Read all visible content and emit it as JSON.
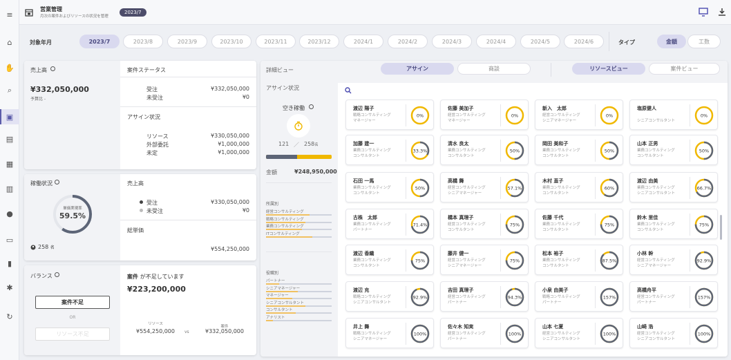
{
  "header": {
    "title": "営業管理",
    "subtitle": "月次の案件およびリソースの状況を管理",
    "period_badge": "2023/7"
  },
  "sidebar": {
    "items": [
      "menu-icon",
      "home-icon",
      "hand-icon",
      "search-doc-icon",
      "calendar-icon",
      "card-icon",
      "building-icon",
      "office-icon",
      "person-icon",
      "wallet-icon",
      "chart-icon",
      "gear-icon",
      "refresh-icon"
    ],
    "active": 4
  },
  "month_bar": {
    "label": "対象年月",
    "months": [
      "2023/7",
      "2023/8",
      "2023/9",
      "2023/10",
      "2023/11",
      "2023/12",
      "2024/1",
      "2024/2",
      "2024/3",
      "2024/4",
      "2024/5",
      "2024/6"
    ],
    "selected": "2023/7",
    "type_label": "タイプ",
    "types": [
      "金額",
      "工数"
    ],
    "selected_type": "金額"
  },
  "sales": {
    "title": "売上高",
    "total": "¥332,050,000",
    "budget_label": "予算比 -",
    "status_title": "案件ステータス",
    "received_label": "受注",
    "received_value": "¥332,050,000",
    "unreceived_label": "未受注",
    "unreceived_value": "¥0",
    "assign_title": "アサイン状況",
    "resource_label": "リソース",
    "resource_value": "¥330,050,000",
    "outsourced_label": "外部委託",
    "outsourced_value": "¥1,000,000",
    "undecided_label": "未定",
    "undecided_value": "¥1,000,000"
  },
  "utilization": {
    "title": "稼働状況",
    "gauge_label": "単価実現率",
    "gauge_value": "59.5%",
    "gauge_fraction": 0.595,
    "people": "258",
    "people_unit": "名",
    "sales_title": "売上高",
    "legend_received": "受注",
    "legend_received_value": "¥330,050,000",
    "legend_unreceived": "未受注",
    "legend_unreceived_value": "¥0",
    "unit_price_title": "総単価",
    "unit_price_value": "¥554,250,000"
  },
  "balance": {
    "title": "バランス",
    "shortage_btn": "案件不足",
    "or_label": "OR",
    "resource_shortage_btn": "リソース不足",
    "message_prefix": "案件",
    "message_suffix": "が不足しています",
    "amount": "¥223,200,000",
    "resource_label": "リソース",
    "resource_value": "¥554,250,000",
    "vs_label": "vs",
    "case_label": "案件",
    "case_value": "¥332,050,000"
  },
  "detail": {
    "title": "詳細ビュー",
    "tabs": [
      "アサイン",
      "商談"
    ],
    "selected_tab": "アサイン",
    "view_tabs": [
      "リソースビュー",
      "案件ビュー"
    ],
    "selected_view": "リソースビュー",
    "assign_status_title": "アサイン状況",
    "idle_label": "空き稼働",
    "idle_count": "121",
    "total_count": "258",
    "count_unit": "名",
    "idle_fraction": 0.469,
    "amount_label": "金額",
    "amount_value": "¥248,950,000",
    "dept_title": "所属別",
    "depts": [
      {
        "name": "経営コンサルティング",
        "fill": 0.66
      },
      {
        "name": "戦略コンサルティング",
        "fill": 0.6
      },
      {
        "name": "業務コンサルティング",
        "fill": 0.55
      },
      {
        "name": "ITコンサルティング",
        "fill": 0.7
      }
    ],
    "role_title": "役職別",
    "roles": [
      {
        "name": "パートナー",
        "fill": 0.2
      },
      {
        "name": "シニアマネージャー",
        "fill": 0.48
      },
      {
        "name": "マネージャー",
        "fill": 0.4
      },
      {
        "name": "シニアコンサルタント",
        "fill": 0.6
      },
      {
        "name": "コンサルタント",
        "fill": 0.45
      },
      {
        "name": "アナリスト",
        "fill": 0.1
      }
    ]
  },
  "resources": [
    {
      "name": "渡辺 陽子",
      "dept": "戦略コンサルティング",
      "role": "マネージャー",
      "pct": "0%",
      "frac": 0
    },
    {
      "name": "佐藤 美加子",
      "dept": "経営コンサルティング",
      "role": "マネージャー",
      "pct": "0%",
      "frac": 0
    },
    {
      "name": "新入　太郎",
      "dept": "経営コンサルティング",
      "role": "シニアマネージャー",
      "pct": "0%",
      "frac": 0
    },
    {
      "name": "塩原健人",
      "dept": "",
      "role": "シニアコンサルタント",
      "pct": "0%",
      "frac": 0
    },
    {
      "name": "加藤 建一",
      "dept": "業務コンサルティング",
      "role": "コンサルタント",
      "pct": "33.3%",
      "frac": 0.333
    },
    {
      "name": "清水 良太",
      "dept": "業務コンサルティング",
      "role": "コンサルタント",
      "pct": "50%",
      "frac": 0.5
    },
    {
      "name": "岡田 美和子",
      "dept": "業務コンサルティング",
      "role": "コンサルタント",
      "pct": "50%",
      "frac": 0.5
    },
    {
      "name": "山本 正男",
      "dept": "業務コンサルティング",
      "role": "コンサルタント",
      "pct": "50%",
      "frac": 0.5
    },
    {
      "name": "石田 一馬",
      "dept": "業務コンサルティング",
      "role": "コンサルタント",
      "pct": "50%",
      "frac": 0.5
    },
    {
      "name": "高橋 舞",
      "dept": "経営コンサルティング",
      "role": "シニアマネージャー",
      "pct": "57.1%",
      "frac": 0.571
    },
    {
      "name": "木村 直子",
      "dept": "業務コンサルティング",
      "role": "コンサルタント",
      "pct": "60%",
      "frac": 0.6
    },
    {
      "name": "渡辺 由美",
      "dept": "業務コンサルティング",
      "role": "シニアコンサルタント",
      "pct": "66.7%",
      "frac": 0.667
    },
    {
      "name": "古株　太郎",
      "dept": "業務コンサルティング",
      "role": "パートナー",
      "pct": "71.4%",
      "frac": 0.714
    },
    {
      "name": "橋本 真理子",
      "dept": "経営コンサルティング",
      "role": "コンサルタント",
      "pct": "75%",
      "frac": 0.75
    },
    {
      "name": "佐藤 千代",
      "dept": "業務コンサルティング",
      "role": "コンサルタント",
      "pct": "75%",
      "frac": 0.75
    },
    {
      "name": "鈴木 里佳",
      "dept": "業務コンサルティング",
      "role": "コンサルタント",
      "pct": "75%",
      "frac": 0.75
    },
    {
      "name": "渡辺 香織",
      "dept": "業務コンサルティング",
      "role": "コンサルタント",
      "pct": "75%",
      "frac": 0.75
    },
    {
      "name": "藤井 健一",
      "dept": "経営コンサルティング",
      "role": "シニアマネージャー",
      "pct": "75%",
      "frac": 0.75
    },
    {
      "name": "松本 裕子",
      "dept": "業務コンサルティング",
      "role": "コンサルタント",
      "pct": "87.5%",
      "frac": 0.875
    },
    {
      "name": "小林 幹",
      "dept": "経営コンサルティング",
      "role": "シニアマネージャー",
      "pct": "92.9%",
      "frac": 0.929
    },
    {
      "name": "渡辺 充",
      "dept": "戦略コンサルティング",
      "role": "シニアコンサルタント",
      "pct": "92.9%",
      "frac": 0.929
    },
    {
      "name": "吉田 真理子",
      "dept": "経営コンサルティング",
      "role": "パートナー",
      "pct": "94.3%",
      "frac": 0.943
    },
    {
      "name": "小泉 由美子",
      "dept": "戦略コンサルティング",
      "role": "パートナー",
      "pct": "157%",
      "frac": 1
    },
    {
      "name": "高橋舟平",
      "dept": "経営コンサルティング",
      "role": "パートナー",
      "pct": "157%",
      "frac": 1
    },
    {
      "name": "井上 舞",
      "dept": "戦略コンサルティング",
      "role": "シニアマネージャー",
      "pct": "100%",
      "frac": 1
    },
    {
      "name": "佐々木 知実",
      "dept": "経営コンサルティング",
      "role": "パートナー",
      "pct": "100%",
      "frac": 1
    },
    {
      "name": "山本 七夏",
      "dept": "経営コンサルティング",
      "role": "シニアコンサルタント",
      "pct": "100%",
      "frac": 1
    },
    {
      "name": "山崎 浩",
      "dept": "経営コンサルティング",
      "role": "シニアコンサルタント",
      "pct": "100%",
      "frac": 1
    }
  ],
  "colors": {
    "accent": "#5c5caa",
    "gauge_dark": "#5d6577",
    "gauge_yellow": "#f0b800",
    "selected_pill": "#d9d9ef"
  }
}
